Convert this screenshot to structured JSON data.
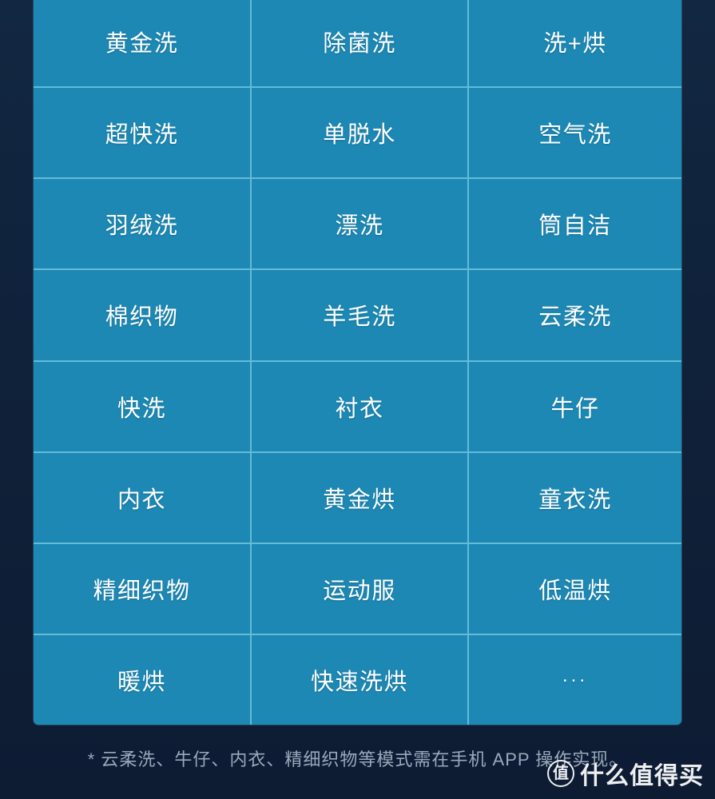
{
  "table": {
    "columns": 3,
    "rows": [
      [
        "黄金洗",
        "除菌洗",
        "洗+烘"
      ],
      [
        "超快洗",
        "单脱水",
        "空气洗"
      ],
      [
        "羽绒洗",
        "漂洗",
        "筒自洁"
      ],
      [
        "棉织物",
        "羊毛洗",
        "云柔洗"
      ],
      [
        "快洗",
        "衬衣",
        "牛仔"
      ],
      [
        "内衣",
        "黄金烘",
        "童衣洗"
      ],
      [
        "精细织物",
        "运动服",
        "低温烘"
      ],
      [
        "暖烘",
        "快速洗烘",
        "..."
      ]
    ]
  },
  "footnote": {
    "text": "* 云柔洗、牛仔、内衣、精细织物等模式需在手机 APP 操作实现。"
  },
  "watermark": {
    "badge": "值",
    "text": "什么值得买"
  },
  "colors": {
    "background": "#122540",
    "table_fill": "#1d88b4",
    "grid_line": "#63bcd8",
    "cell_text": "#ffffff",
    "footnote_text": "#9aa8bb",
    "watermark_text": "#ffffff"
  }
}
